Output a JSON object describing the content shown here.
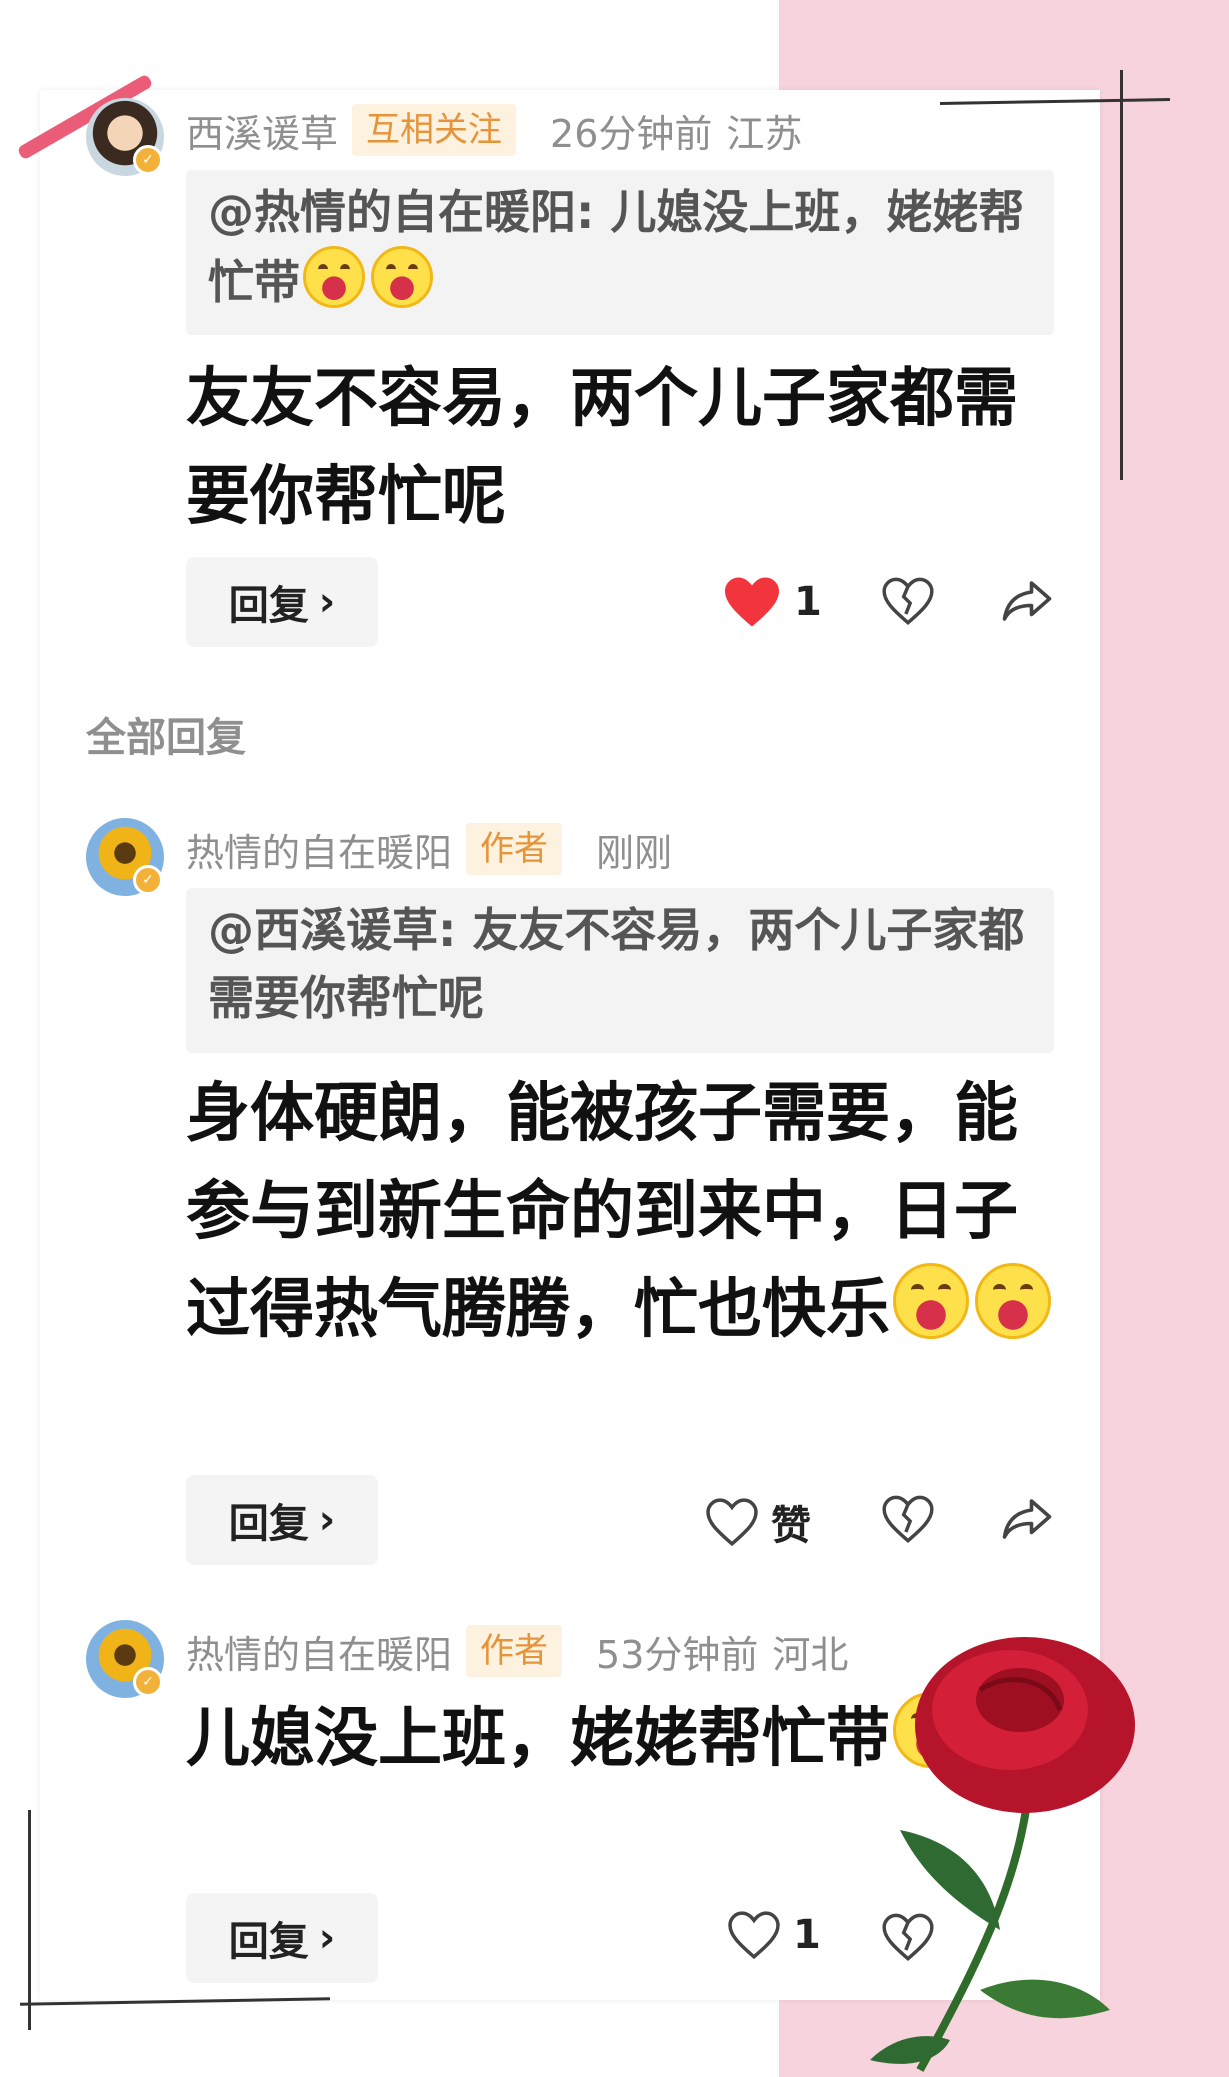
{
  "comment1": {
    "username": "西溪谖草",
    "tag": "互相关注",
    "time": "26分钟前",
    "location": "江苏",
    "quote": "@热情的自在暖阳: 儿媳没上班，姥姥帮忙带",
    "content": "友友不容易，两个儿子家都需要你帮忙呢",
    "reply_label": "回复",
    "like_count": "1",
    "liked": true
  },
  "section_title": "全部回复",
  "comment2": {
    "username": "热情的自在暖阳",
    "tag": "作者",
    "time": "刚刚",
    "quote": "@西溪谖草: 友友不容易，两个儿子家都需要你帮忙呢",
    "content": "身体硬朗，能被孩子需要，能参与到新生命的到来中，日子过得热气腾腾，忙也快乐",
    "reply_label": "回复",
    "like_label": "赞"
  },
  "comment3": {
    "username": "热情的自在暖阳",
    "tag": "作者",
    "time": "53分钟前",
    "location": "河北",
    "content": "儿媳没上班，姥姥帮忙带",
    "reply_label": "回复",
    "like_count": "1"
  },
  "icons": {
    "like_filled": "heart-filled-icon",
    "like": "heart-outline-icon",
    "dislike": "broken-heart-icon",
    "share": "share-arrow-icon",
    "chevron": "chevron-right-icon",
    "emoji": "laughing-emoji-icon"
  },
  "colors": {
    "like_red": "#f2343d",
    "tag_orange": "#e6943a",
    "badge_gold": "#f2b23a",
    "pink_background": "#f7d3dd"
  }
}
